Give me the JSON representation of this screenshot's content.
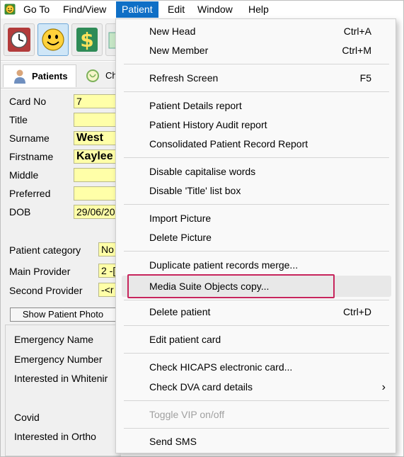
{
  "menubar": {
    "items": [
      "Go To",
      "Find/View",
      "Patient",
      "Edit",
      "Window",
      "Help"
    ],
    "active": "Patient"
  },
  "tabs": [
    {
      "label": "Patients",
      "icon": "person-icon"
    },
    {
      "label": "Ch",
      "icon": "chart-icon"
    }
  ],
  "form": {
    "card_no_label": "Card No",
    "card_no_value": "7",
    "title_label": "Title",
    "title_value": "",
    "surname_label": "Surname",
    "surname_value": "West",
    "firstname_label": "Firstname",
    "firstname_value": "Kaylee",
    "middle_label": "Middle",
    "middle_value": "",
    "preferred_label": "Preferred",
    "preferred_value": "",
    "dob_label": "DOB",
    "dob_value": "29/06/20",
    "patient_category_label": "Patient category",
    "patient_category_value": "No",
    "main_provider_label": "Main Provider",
    "main_provider_value": "2 -[",
    "second_provider_label": "Second Provider",
    "second_provider_value": "-<r",
    "show_photo_button": "Show Patient Photo",
    "emergency_name_label": "Emergency Name",
    "emergency_number_label": "Emergency Number",
    "interested_whitening_label": "Interested in Whitenir",
    "covid_label": "Covid",
    "interested_ortho_label": "Interested in Ortho"
  },
  "patient_menu": {
    "new_head": {
      "label": "New Head",
      "shortcut": "Ctrl+A"
    },
    "new_member": {
      "label": "New Member",
      "shortcut": "Ctrl+M"
    },
    "refresh_screen": {
      "label": "Refresh Screen",
      "shortcut": "F5"
    },
    "patient_details_report": {
      "label": "Patient Details report"
    },
    "patient_history_audit_report": {
      "label": "Patient History Audit report"
    },
    "consolidated_record_report": {
      "label": "Consolidated Patient Record Report"
    },
    "disable_capitalise": {
      "label": "Disable capitalise words"
    },
    "disable_title_list": {
      "label": "Disable 'Title' list box"
    },
    "import_picture": {
      "label": "Import Picture"
    },
    "delete_picture": {
      "label": "Delete Picture"
    },
    "duplicate_merge": {
      "label": "Duplicate patient records merge..."
    },
    "media_suite_copy": {
      "label": "Media Suite Objects copy..."
    },
    "delete_patient": {
      "label": "Delete patient",
      "shortcut": "Ctrl+D"
    },
    "edit_patient_card": {
      "label": "Edit patient card"
    },
    "check_hicaps": {
      "label": "Check HICAPS electronic card..."
    },
    "check_dva": {
      "label": "Check DVA card details"
    },
    "toggle_vip": {
      "label": "Toggle VIP on/off",
      "disabled": true
    },
    "send_sms": {
      "label": "Send SMS"
    }
  },
  "colors": {
    "menu_active": "#0f6fc6",
    "field_bg": "#ffffa8",
    "highlight_border": "#c7255c"
  }
}
